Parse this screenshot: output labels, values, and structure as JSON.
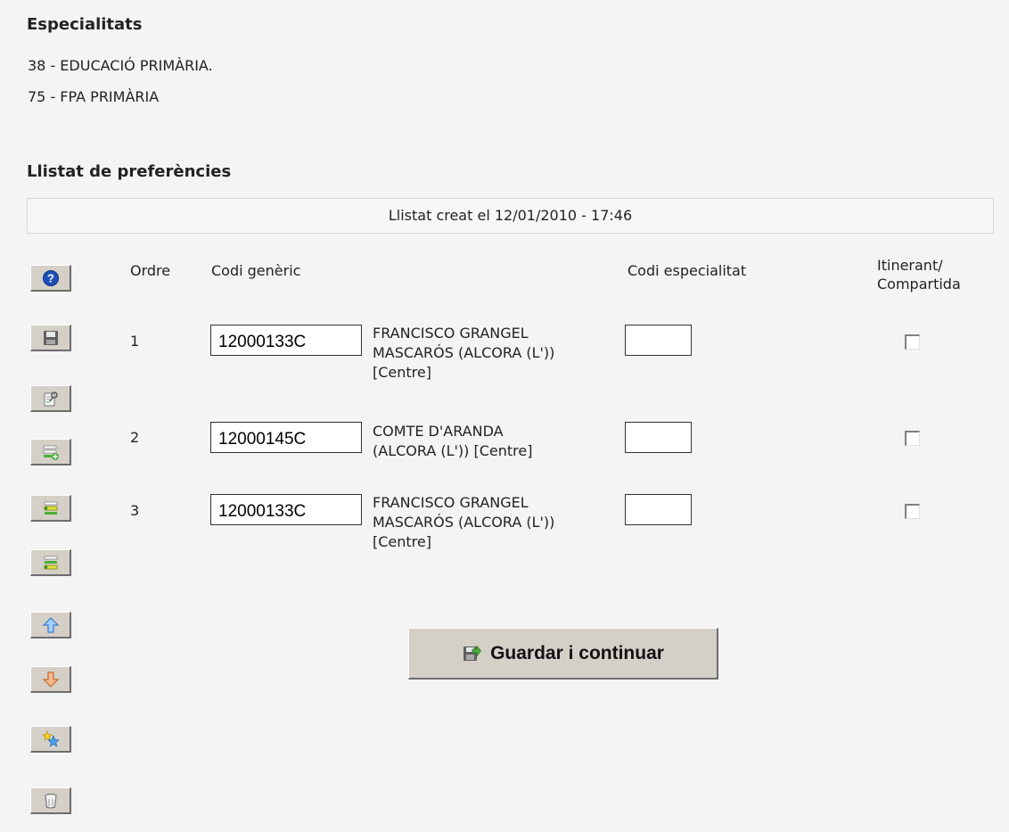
{
  "specialties": {
    "title": "Especialitats",
    "items": [
      "38 - EDUCACIÓ PRIMÀRIA.",
      "75 - FPA PRIMÀRIA"
    ]
  },
  "preferences": {
    "title": "Llistat de preferències",
    "banner": "Llistat creat el 12/01/2010 - 17:46",
    "headers": {
      "order": "Ordre",
      "generic_code": "Codi genèric",
      "specialty_code": "Codi especialitat",
      "itinerant_line1": "Itinerant/",
      "itinerant_line2": "Compartida"
    },
    "rows": [
      {
        "order": "1",
        "code": "12000133C",
        "name_line1": "FRANCISCO GRANGEL",
        "name_line2": "MASCARÓS (ALCORA (L'))",
        "name_line3": "[Centre]",
        "specialty": "",
        "checked": false
      },
      {
        "order": "2",
        "code": "12000145C",
        "name_line1": "COMTE D'ARANDA",
        "name_line2": "(ALCORA (L')) [Centre]",
        "name_line3": "",
        "specialty": "",
        "checked": false
      },
      {
        "order": "3",
        "code": "12000133C",
        "name_line1": "FRANCISCO GRANGEL",
        "name_line2": "MASCARÓS (ALCORA (L'))",
        "name_line3": "[Centre]",
        "specialty": "",
        "checked": false
      }
    ]
  },
  "toolbar": {
    "buttons": [
      {
        "name": "help-button",
        "icon": "help-icon"
      },
      {
        "name": "save-button",
        "icon": "floppy-disk-icon"
      },
      {
        "name": "search-centre-button",
        "icon": "search-document-icon"
      },
      {
        "name": "add-row-button",
        "icon": "add-row-icon"
      },
      {
        "name": "insert-row-above-button",
        "icon": "insert-above-icon"
      },
      {
        "name": "insert-row-below-button",
        "icon": "insert-below-icon"
      },
      {
        "name": "move-up-button",
        "icon": "arrow-up-icon"
      },
      {
        "name": "move-down-button",
        "icon": "arrow-down-icon"
      },
      {
        "name": "favorites-button",
        "icon": "stars-icon"
      },
      {
        "name": "delete-button",
        "icon": "trash-icon"
      }
    ]
  },
  "actions": {
    "save_continue_label": "Guardar i continuar"
  },
  "colors": {
    "background": "#f4f4f4",
    "button_face": "#d4d0c8",
    "help_blue": "#1c4fb8",
    "arrow_up_blue": "#5aa0e6",
    "arrow_down_orange": "#e6a070",
    "add_green": "#4caf3a",
    "insert_yellow": "#e0e040"
  }
}
